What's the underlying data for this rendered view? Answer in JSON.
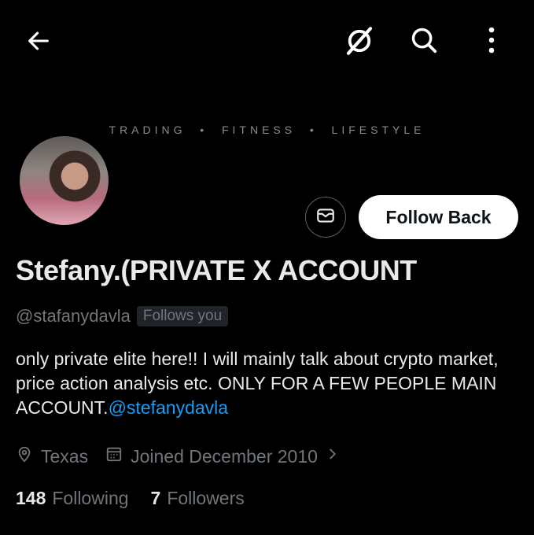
{
  "header": {
    "back_icon": "arrow-left-icon",
    "grok_icon": "grok-icon",
    "search_icon": "search-icon",
    "more_icon": "more-vertical-icon"
  },
  "banner": {
    "tagline": "TRADING  •  FITNESS  •  LIFESTYLE"
  },
  "profile": {
    "display_name": "Stefany.(PRIVATE X ACCOUNT",
    "handle": "@stafanydavla",
    "follows_you": "Follows you",
    "bio_text": "only private elite here!! I will mainly talk about crypto market, price action analysis etc. ONLY FOR A FEW PEOPLE MAIN ACCOUNT.",
    "bio_mention": "@stefanydavla",
    "location": "Texas",
    "joined": "Joined December 2010",
    "following_count": "148",
    "following_label": "Following",
    "followers_count": "7",
    "followers_label": "Followers"
  },
  "actions": {
    "message_icon": "mail-icon",
    "follow_back_label": "Follow Back"
  },
  "colors": {
    "background": "#000000",
    "text_primary": "#e7e9ea",
    "text_secondary": "#71767b",
    "link": "#1d9bf0",
    "button_bg": "#ffffff"
  }
}
